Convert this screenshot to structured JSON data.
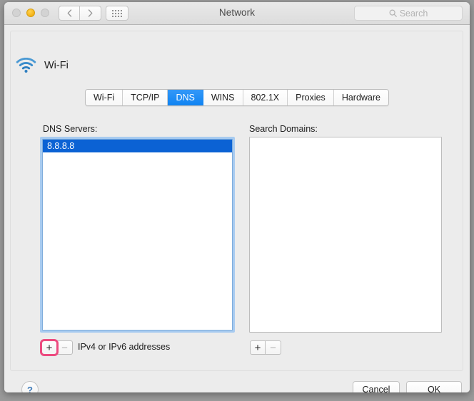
{
  "window": {
    "title": "Network",
    "traffic_lights": [
      {
        "name": "close",
        "color": "#d3d3d3",
        "enabled": false
      },
      {
        "name": "minimize",
        "color": "#f3b015",
        "enabled": true
      },
      {
        "name": "zoom",
        "color": "#d3d3d3",
        "enabled": false
      }
    ],
    "nav": {
      "back_icon": "chevron-left-icon",
      "forward_icon": "chevron-right-icon",
      "grid_icon": "show-all-grid-icon"
    },
    "search": {
      "placeholder": "Search",
      "icon": "search-icon"
    }
  },
  "interface": {
    "icon": "wifi-icon",
    "name": "Wi-Fi"
  },
  "tabs": [
    {
      "label": "Wi-Fi",
      "selected": false
    },
    {
      "label": "TCP/IP",
      "selected": false
    },
    {
      "label": "DNS",
      "selected": true
    },
    {
      "label": "WINS",
      "selected": false
    },
    {
      "label": "802.1X",
      "selected": false
    },
    {
      "label": "Proxies",
      "selected": false
    },
    {
      "label": "Hardware",
      "selected": false
    }
  ],
  "dns_servers": {
    "label": "DNS Servers:",
    "entries": [
      {
        "value": "8.8.8.8",
        "selected": true
      }
    ],
    "add_label": "+",
    "remove_label": "−",
    "hint": "IPv4 or IPv6 addresses",
    "add_highlighted": true
  },
  "search_domains": {
    "label": "Search Domains:",
    "entries": [],
    "add_label": "+",
    "remove_label": "−"
  },
  "footer": {
    "help_label": "?",
    "cancel_label": "Cancel",
    "ok_label": "OK"
  },
  "colors": {
    "tab_selected": "#0f83f2",
    "row_selected": "#0b62d4",
    "highlight_ring": "#ec4a7f",
    "wifi_icon": "#2f7fc1",
    "help_glyph": "#3d7ab8"
  }
}
